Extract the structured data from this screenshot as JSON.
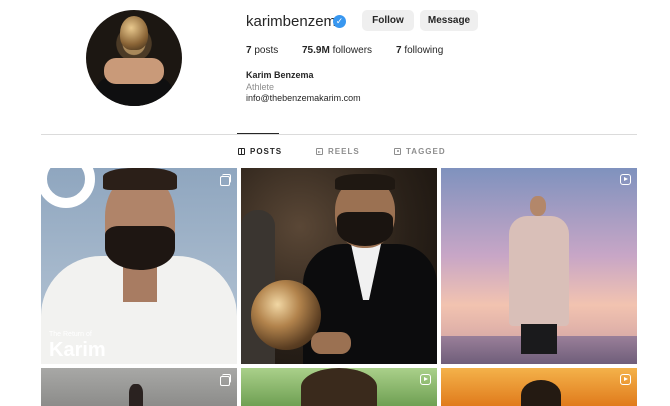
{
  "profile": {
    "username": "karimbenzema",
    "verified_icon": "verified-badge-icon",
    "follow_label": "Follow",
    "message_label": "Message",
    "stats": {
      "posts_count": "7",
      "posts_label": "posts",
      "followers_count": "75.9M",
      "followers_label": "followers",
      "following_count": "7",
      "following_label": "following"
    },
    "full_name": "Karim Benzema",
    "category": "Athlete",
    "email": "info@thebenzemakarim.com"
  },
  "tabs": [
    {
      "label": "POSTS",
      "icon": "grid-icon",
      "active": true
    },
    {
      "label": "REELS",
      "icon": "reels-icon",
      "active": false
    },
    {
      "label": "TAGGED",
      "icon": "tagged-icon",
      "active": false
    }
  ],
  "posts": [
    {
      "type_icon": "carousel-icon",
      "cover_small": "The Return of",
      "cover_big": "Karim"
    },
    {
      "type_icon": ""
    },
    {
      "type_icon": "reel-icon"
    },
    {
      "type_icon": "carousel-icon"
    },
    {
      "type_icon": "reel-icon"
    },
    {
      "type_icon": "reel-icon"
    }
  ],
  "colors": {
    "verified_blue": "#3897f0",
    "button_bg": "#efefef",
    "muted_text": "#8e8e8e",
    "divider": "#dbdbdb"
  }
}
